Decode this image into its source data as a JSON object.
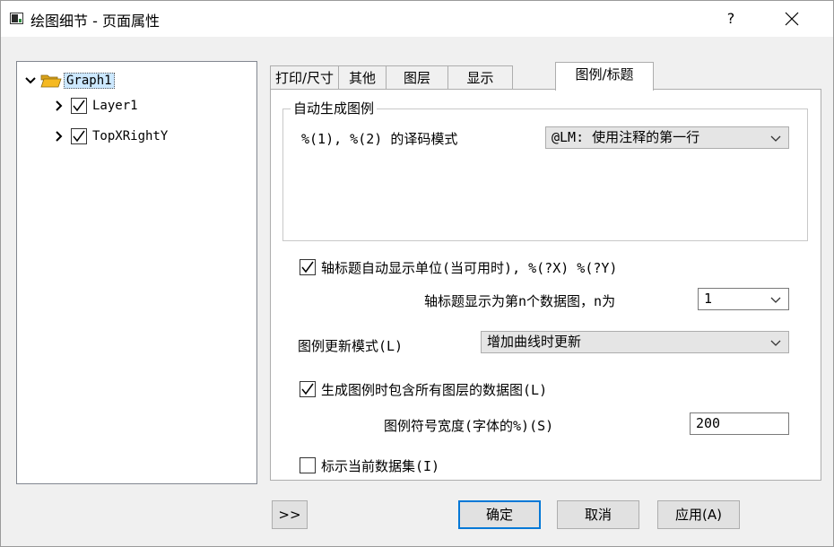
{
  "window": {
    "title": "绘图细节 - 页面属性",
    "help_label": "?"
  },
  "tree": {
    "root": {
      "label": "Graph1"
    },
    "children": [
      {
        "label": "Layer1",
        "checked": true
      },
      {
        "label": "TopXRightY",
        "checked": true
      }
    ]
  },
  "tabs": [
    {
      "label": "打印/尺寸",
      "active": false
    },
    {
      "label": "其他",
      "active": false
    },
    {
      "label": "图层",
      "active": false
    },
    {
      "label": "显示",
      "active": false
    },
    {
      "label": "图例/标题",
      "active": true
    }
  ],
  "legend_group": {
    "title": "自动生成图例",
    "decode_label": "%(1), %(2) 的译码模式",
    "decode_value": "@LM: 使用注释的第一行"
  },
  "axis_units": {
    "label": "轴标题自动显示单位(当可用时), %(?X) %(?Y)",
    "checked": true
  },
  "axis_nth": {
    "label": "轴标题显示为第n个数据图，n为",
    "value": "1"
  },
  "update_mode": {
    "label": "图例更新模式(L)",
    "value": "增加曲线时更新"
  },
  "include_all": {
    "label": "生成图例时包含所有图层的数据图(L)",
    "checked": true
  },
  "symbol_width": {
    "label": "图例符号宽度(字体的%)(S)",
    "value": "200"
  },
  "indicate_current": {
    "label": "标示当前数据集(I)",
    "checked": false
  },
  "footer": {
    "expand_label": ">>",
    "ok_label": "确定",
    "cancel_label": "取消",
    "apply_label": "应用(A)"
  },
  "colors": {
    "accent": "#0078d7",
    "selection": "#cce8ff",
    "folder": "#f5b921"
  }
}
